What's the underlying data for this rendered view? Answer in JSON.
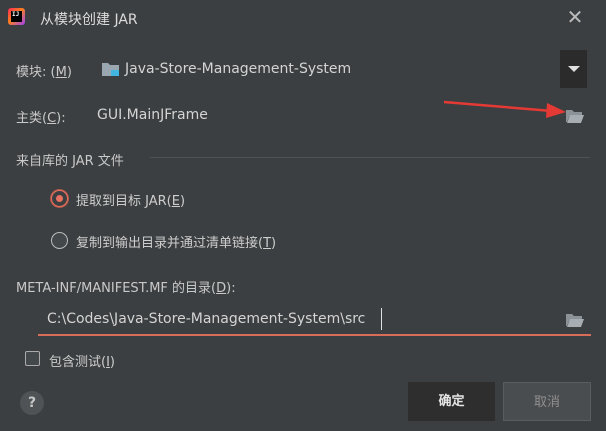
{
  "window": {
    "title": "从模块创建 JAR",
    "close_glyph": "✕",
    "app_icon_text": "IJ"
  },
  "module": {
    "label_prefix": "模块: (",
    "label_mnemonic": "M",
    "label_suffix": ")",
    "value": "Java-Store-Management-System",
    "icon": "module-folder-icon"
  },
  "main_class": {
    "label_prefix": "主类(",
    "label_mnemonic": "C",
    "label_suffix": "):",
    "value": "GUI.MainJFrame",
    "browse_icon": "folder-open-icon"
  },
  "library_section": {
    "title": "来自库的 JAR 文件",
    "options": [
      {
        "prefix": "提取到目标 JAR(",
        "mnemonic": "E",
        "suffix": ")",
        "selected": true
      },
      {
        "prefix": "复制到输出目录并通过清单链接(",
        "mnemonic": "T",
        "suffix": ")",
        "selected": false
      }
    ]
  },
  "manifest": {
    "label_prefix": "META-INF/MANIFEST.MF 的目录(",
    "label_mnemonic": "D",
    "label_suffix": "):",
    "value": "C:\\Codes\\Java-Store-Management-System\\src",
    "browse_icon": "folder-open-icon"
  },
  "include_tests": {
    "prefix": "包含测试(",
    "mnemonic": "I",
    "suffix": ")",
    "checked": false
  },
  "buttons": {
    "help": "?",
    "ok": "确定",
    "cancel": "取消"
  },
  "colors": {
    "background": "#3c3f41",
    "accent": "#e8715f",
    "annotation_arrow": "#e53935"
  }
}
